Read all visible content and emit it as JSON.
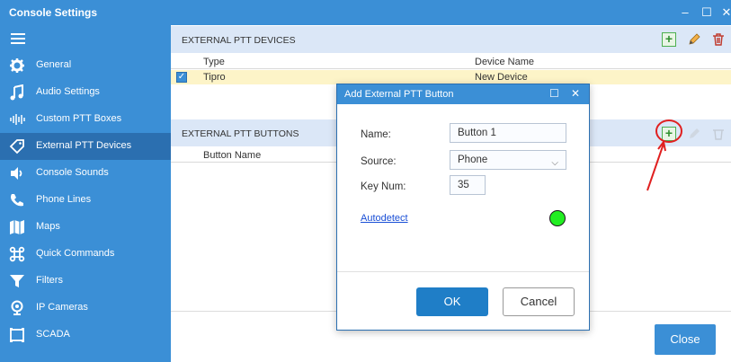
{
  "window": {
    "title": "Console Settings",
    "minimize": "–",
    "maximize": "☐",
    "close": "✕"
  },
  "sidebar": {
    "items": [
      {
        "label": "General",
        "icon": "gear-icon"
      },
      {
        "label": "Audio Settings",
        "icon": "music-note-icon"
      },
      {
        "label": "Custom PTT Boxes",
        "icon": "equalizer-icon"
      },
      {
        "label": "External PTT Devices",
        "icon": "tag-icon"
      },
      {
        "label": "Console Sounds",
        "icon": "speaker-icon"
      },
      {
        "label": "Phone Lines",
        "icon": "phone-icon"
      },
      {
        "label": "Maps",
        "icon": "map-icon"
      },
      {
        "label": "Quick Commands",
        "icon": "command-icon"
      },
      {
        "label": "Filters",
        "icon": "filter-icon"
      },
      {
        "label": "IP Cameras",
        "icon": "camera-icon"
      },
      {
        "label": "SCADA",
        "icon": "scada-icon"
      }
    ],
    "active_index": 3
  },
  "devices_section": {
    "title": "EXTERNAL PTT DEVICES",
    "columns": [
      "Type",
      "Device Name"
    ],
    "rows": [
      {
        "checked": true,
        "type": "Tipro",
        "device_name": "New Device"
      }
    ]
  },
  "buttons_section": {
    "title": "EXTERNAL PTT BUTTONS",
    "columns": [
      "Button Name"
    ]
  },
  "dialog": {
    "title": "Add External PTT Button",
    "name_label": "Name:",
    "name_value": "Button 1",
    "source_label": "Source:",
    "source_value": "Phone",
    "keynum_label": "Key Num:",
    "keynum_value": "35",
    "autodetect_label": "Autodetect",
    "status_color": "#22ee22",
    "ok_label": "OK",
    "cancel_label": "Cancel"
  },
  "footer": {
    "close_label": "Close"
  },
  "colors": {
    "accent": "#3b8fd6",
    "active_sidebar": "#2b6fb0",
    "annotation": "#e02020"
  }
}
